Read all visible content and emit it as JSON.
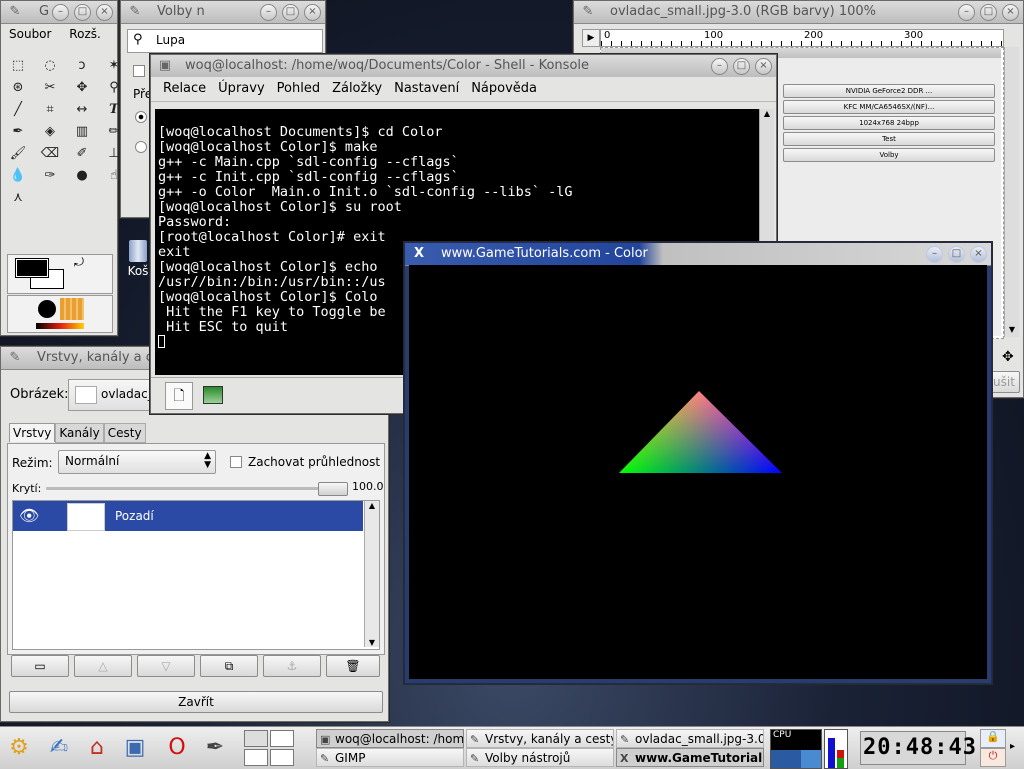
{
  "colors": {
    "selection": "#2b4aa6",
    "accent": "#22449a",
    "terminal_bg": "#000000",
    "terminal_fg": "#ffffff"
  },
  "desktop": {
    "trash_label": "Koš"
  },
  "toolbox": {
    "title": "G",
    "menu": [
      "Soubor",
      "Rozš."
    ],
    "tools": [
      "rect-select-icon",
      "ellipse-select-icon",
      "lasso-icon",
      "fuzzy-select-icon",
      "color-select-icon",
      "scissors-icon",
      "move-icon",
      "magnify-icon",
      "measure-icon",
      "crop-icon",
      "flip-icon",
      "text-icon",
      "picker-icon",
      "bucket-icon",
      "gradient-icon",
      "pencil-icon",
      "brush-icon",
      "eraser-icon",
      "airbrush-icon",
      "clone-icon",
      "blur-icon",
      "ink-icon",
      "dodge-icon",
      "smudge-icon",
      "path-icon"
    ]
  },
  "tool_options": {
    "title": "Volby n",
    "tool_name": "Lupa",
    "label": "Pře"
  },
  "image_window": {
    "title": "ovladac_small.jpg-3.0 (RGB barvy) 100%",
    "ruler_ticks": [
      "0",
      "100",
      "200",
      "300"
    ],
    "buttons": [
      "NVIDIA GeForce2 DDR ...",
      "KFC MM/CA6546SX/(NF)...",
      "1024x768 24bpp",
      "Test",
      "Volby"
    ],
    "cancel_label": "ušit"
  },
  "layers": {
    "title": "Vrstvy, kanály a cesty",
    "image_label": "Obrázek:",
    "image_name": "ovladac_",
    "tabs": [
      "Vrstvy",
      "Kanály",
      "Cesty"
    ],
    "mode_label": "Režim:",
    "mode_value": "Normální",
    "keep_alpha": "Zachovat průhlednost",
    "opacity_label": "Krytí:",
    "opacity_value": "100.0",
    "layer_name": "Pozadí",
    "close_label": "Zavřít"
  },
  "konsole": {
    "title": "woq@localhost: /home/woq/Documents/Color - Shell - Konsole",
    "menu": [
      "Relace",
      "Úpravy",
      "Pohled",
      "Záložky",
      "Nastavení",
      "Nápověda"
    ],
    "lines": [
      "[woq@localhost Documents]$ cd Color",
      "[woq@localhost Color]$ make",
      "g++ -c Main.cpp `sdl-config --cflags`",
      "g++ -c Init.cpp `sdl-config --cflags`",
      "g++ -o Color  Main.o Init.o `sdl-config --libs` -lG",
      "[woq@localhost Color]$ su root",
      "Password:",
      "[root@localhost Color]# exit",
      "exit",
      "[woq@localhost Color]$ echo",
      "/usr//bin:/bin:/usr/bin::/us",
      "[woq@localhost Color]$ Colo",
      " Hit the F1 key to Toggle be",
      " Hit ESC to quit"
    ]
  },
  "gl_window": {
    "title": "www.GameTutorials.com - Color"
  },
  "taskbar": {
    "launchers": [
      "kde-menu-icon",
      "home-icon",
      "house-icon",
      "display-icon",
      "opera-icon",
      "editor-icon"
    ],
    "tasks": [
      {
        "label": "woq@localhost: /hom",
        "icon": "terminal-icon"
      },
      {
        "label": "Vrstvy, kanály a cesty",
        "icon": "gimp-icon"
      },
      {
        "label": "ovladac_small.jpg-3.0",
        "icon": "gimp-icon"
      },
      {
        "label": "GIMP",
        "icon": "gimp-icon"
      },
      {
        "label": "Volby nástrojů",
        "icon": "gimp-icon"
      },
      {
        "label": "www.GameTutorials",
        "icon": "x-icon"
      }
    ],
    "cpu_label": "CPU",
    "clock": "20:48:43"
  }
}
